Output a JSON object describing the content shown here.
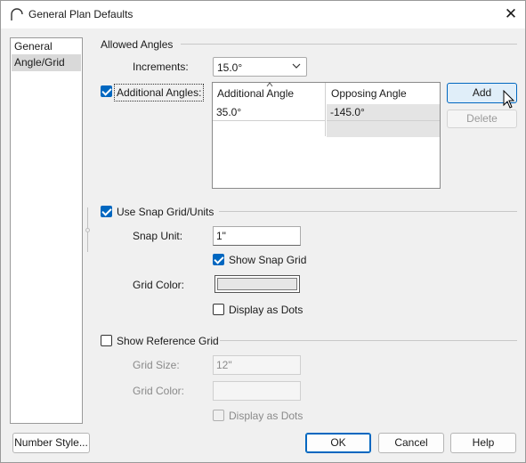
{
  "window": {
    "title": "General Plan Defaults",
    "close_glyph": "✕"
  },
  "nav": {
    "items": [
      {
        "label": "General"
      },
      {
        "label": "Angle/Grid"
      }
    ]
  },
  "allowed_angles": {
    "heading": "Allowed Angles",
    "increments_label": "Increments:",
    "increments_value": "15.0°",
    "additional_label": "Additional Angles:",
    "additional_checked": true,
    "table": {
      "columns": [
        "Additional Angle",
        "Opposing Angle"
      ],
      "rows": [
        {
          "additional": "35.0°",
          "opposing": "-145.0°"
        }
      ]
    },
    "add_label": "Add",
    "delete_label": "Delete"
  },
  "snap": {
    "heading": "Use Snap Grid/Units",
    "checked": true,
    "unit_label": "Snap Unit:",
    "unit_value": "1\"",
    "show_label": "Show Snap Grid",
    "show_checked": true,
    "color_label": "Grid Color:",
    "dots_label": "Display as Dots",
    "dots_checked": false
  },
  "reference": {
    "heading": "Show Reference Grid",
    "checked": false,
    "size_label": "Grid Size:",
    "size_value": "12\"",
    "color_label": "Grid Color:",
    "dots_label": "Display as Dots",
    "dots_checked": false
  },
  "footer": {
    "number_style_label": "Number Style...",
    "ok_label": "OK",
    "cancel_label": "Cancel",
    "help_label": "Help"
  },
  "colors": {
    "accent": "#0067c0",
    "snap_grid_color": "#e6e6e6"
  }
}
